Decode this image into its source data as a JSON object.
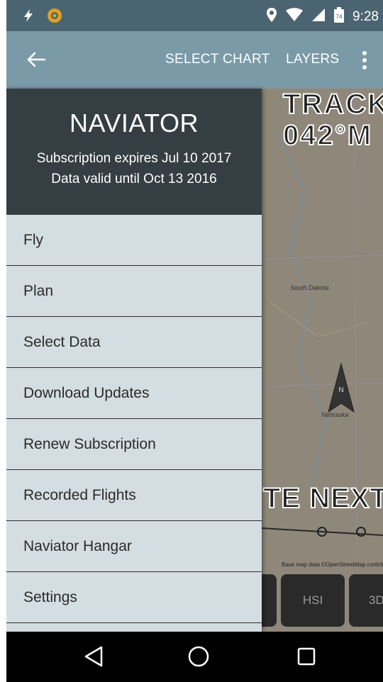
{
  "status_bar": {
    "time": "9:28",
    "icons": [
      "flash-icon",
      "notification-app-icon",
      "location-icon",
      "wifi-icon",
      "signal-icon",
      "battery-icon"
    ]
  },
  "app_bar": {
    "back_icon": "arrow-left-icon",
    "select_chart_label": "SELECT CHART",
    "layers_label": "LAYERS",
    "more_icon": "more-vert-icon"
  },
  "drawer": {
    "title": "NAVIATOR",
    "subscription_line": "Subscription expires Jul 10 2017",
    "data_valid_line": "Data valid until Oct 13 2016",
    "items": [
      {
        "label": "Fly"
      },
      {
        "label": "Plan"
      },
      {
        "label": "Select Data"
      },
      {
        "label": "Download Updates"
      },
      {
        "label": "Renew Subscription"
      },
      {
        "label": "Recorded Flights"
      },
      {
        "label": "Naviator Hangar"
      },
      {
        "label": "Settings"
      }
    ]
  },
  "map": {
    "track_line1": "TRACK",
    "track_line2": "042°M",
    "next_text": "TE NEXT",
    "state_label_1": "South Dakota",
    "state_label_2": "Nebraska",
    "north_label": "N",
    "credit": "Base map data ©OpenStreetMap contributors",
    "hsi_button": "HSI",
    "three_d_button": "3D"
  },
  "colors": {
    "status_bar": "#4a6571",
    "app_bar": "#7b9aa8",
    "drawer_header": "#343e43",
    "drawer_body": "#d3dde2"
  }
}
